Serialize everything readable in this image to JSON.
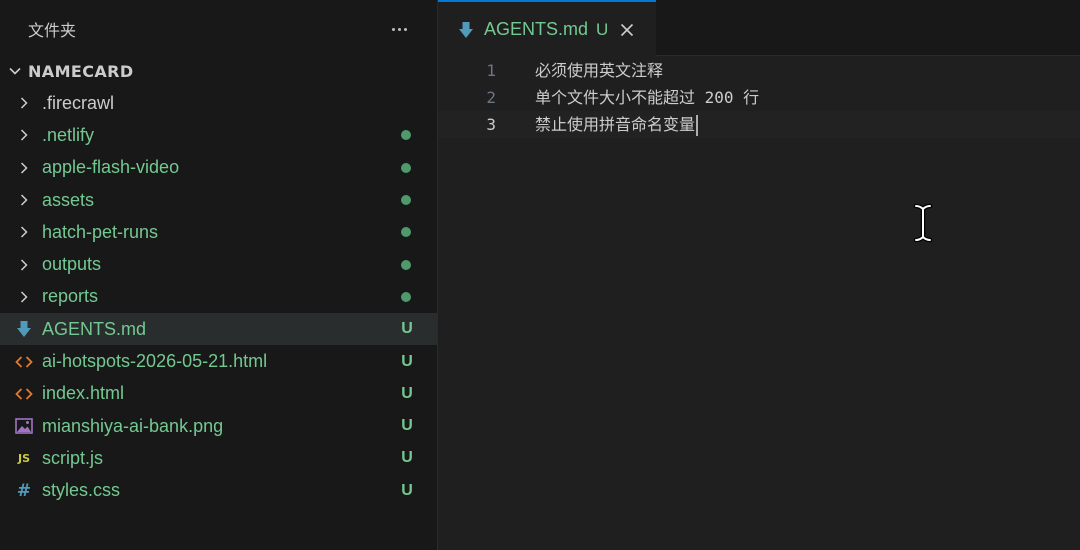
{
  "sidebar": {
    "title": "文件夹",
    "more_icon": "ellipsis-icon",
    "root": {
      "label": "NAMECARD",
      "expanded": true
    },
    "items": [
      {
        "label": ".firecrawl",
        "kind": "folder",
        "status": "",
        "color": "plain"
      },
      {
        "label": ".netlify",
        "kind": "folder",
        "status": "dot",
        "color": "git"
      },
      {
        "label": "apple-flash-video",
        "kind": "folder",
        "status": "dot",
        "color": "git"
      },
      {
        "label": "assets",
        "kind": "folder",
        "status": "dot",
        "color": "git"
      },
      {
        "label": "hatch-pet-runs",
        "kind": "folder",
        "status": "dot",
        "color": "git"
      },
      {
        "label": "outputs",
        "kind": "folder",
        "status": "dot",
        "color": "git"
      },
      {
        "label": "reports",
        "kind": "folder",
        "status": "dot",
        "color": "git"
      },
      {
        "label": "AGENTS.md",
        "kind": "markdown",
        "status": "U",
        "color": "git",
        "selected": true
      },
      {
        "label": "ai-hotspots-2026-05-21.html",
        "kind": "html",
        "status": "U",
        "color": "git"
      },
      {
        "label": "index.html",
        "kind": "html",
        "status": "U",
        "color": "git"
      },
      {
        "label": "mianshiya-ai-bank.png",
        "kind": "image",
        "status": "U",
        "color": "git"
      },
      {
        "label": "script.js",
        "kind": "js",
        "status": "U",
        "color": "git"
      },
      {
        "label": "styles.css",
        "kind": "css",
        "status": "U",
        "color": "git"
      }
    ]
  },
  "editor": {
    "tab": {
      "label": "AGENTS.md",
      "status": "U",
      "icon": "markdown-arrow-icon",
      "close_icon": "close-icon"
    },
    "lines": [
      {
        "number": "1",
        "text": "必须使用英文注释"
      },
      {
        "number": "2",
        "text": "单个文件大小不能超过 200 行"
      },
      {
        "number": "3",
        "text": "禁止使用拼音命名变量",
        "current": true
      }
    ],
    "cursor_icon": "text-ibeam-cursor-icon"
  },
  "colors": {
    "git_untracked": "#73c991",
    "accent": "#0078d4",
    "sidebar_bg": "#181818",
    "editor_bg": "#1f1f1f",
    "html_icon": "#e37933",
    "md_icon": "#519aba",
    "js_icon": "#cbcb41",
    "css_icon": "#519aba",
    "image_icon": "#a074c4"
  }
}
